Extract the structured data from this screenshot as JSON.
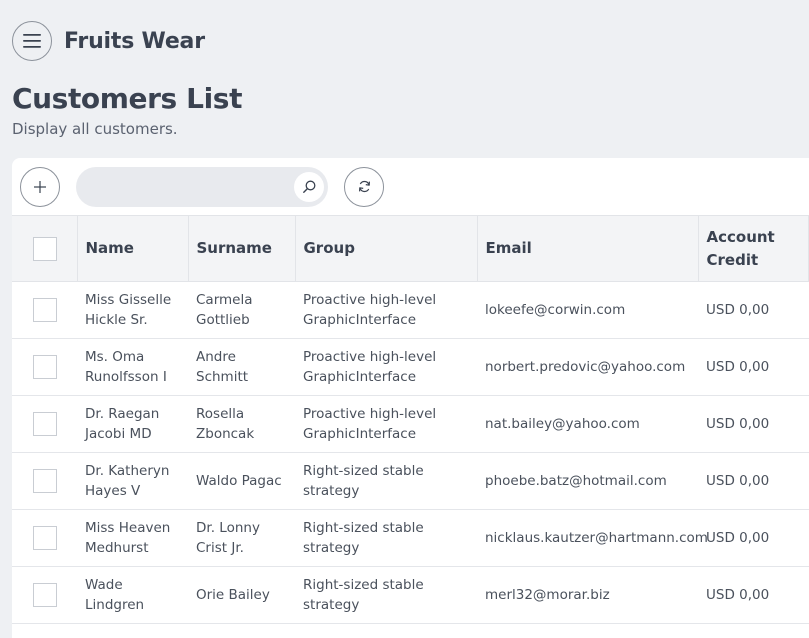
{
  "app": {
    "title": "Fruits Wear"
  },
  "page": {
    "title": "Customers List",
    "subtitle": "Display all customers."
  },
  "search": {
    "placeholder": "",
    "value": ""
  },
  "table": {
    "columns": [
      "Name",
      "Surname",
      "Group",
      "Email",
      "Account Credit"
    ],
    "rows": [
      {
        "name": "Miss Gisselle Hickle Sr.",
        "surname": "Carmela Gottlieb",
        "group": "Proactive high-level GraphicInterface",
        "email": "lokeefe@corwin.com",
        "credit": "USD 0,00"
      },
      {
        "name": "Ms. Oma Runolfsson I",
        "surname": "Andre Schmitt",
        "group": "Proactive high-level GraphicInterface",
        "email": "norbert.predovic@yahoo.com",
        "credit": "USD 0,00"
      },
      {
        "name": "Dr. Raegan Jacobi MD",
        "surname": "Rosella Zboncak",
        "group": "Proactive high-level GraphicInterface",
        "email": "nat.bailey@yahoo.com",
        "credit": "USD 0,00"
      },
      {
        "name": "Dr. Katheryn Hayes V",
        "surname": "Waldo Pagac",
        "group": "Right-sized stable strategy",
        "email": "phoebe.batz@hotmail.com",
        "credit": "USD 0,00"
      },
      {
        "name": "Miss Heaven Medhurst",
        "surname": "Dr. Lonny Crist Jr.",
        "group": "Right-sized stable strategy",
        "email": "nicklaus.kautzer@hartmann.com",
        "credit": "USD 0,00"
      },
      {
        "name": "Wade Lindgren",
        "surname": "Orie Bailey",
        "group": "Right-sized stable strategy",
        "email": "merl32@morar.biz",
        "credit": "USD 0,00"
      }
    ]
  },
  "icons": {
    "menu": "hamburger-icon",
    "add": "plus-icon",
    "search": "search-icon",
    "refresh": "refresh-icon"
  }
}
